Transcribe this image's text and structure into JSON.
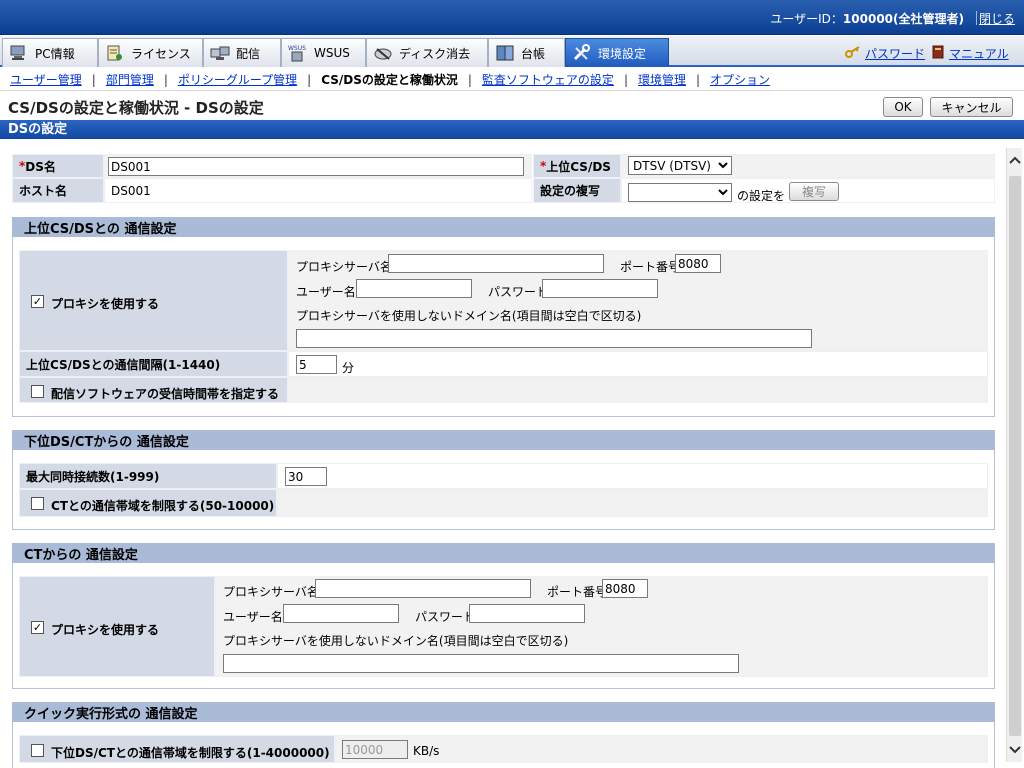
{
  "header": {
    "user_label": "ユーザーID：",
    "user_value": "100000(全社管理者)",
    "close_label": "閉じる"
  },
  "tabs": [
    {
      "label": "PC情報",
      "icon": "pc-icon"
    },
    {
      "label": "ライセンス",
      "icon": "license-icon"
    },
    {
      "label": "配信",
      "icon": "distribute-icon"
    },
    {
      "label": "WSUS",
      "icon": "wsus-icon"
    },
    {
      "label": "ディスク消去",
      "icon": "disk-erase-icon"
    },
    {
      "label": "台帳",
      "icon": "ledger-icon"
    },
    {
      "label": "環境設定",
      "icon": "settings-tools-icon",
      "active": true
    }
  ],
  "tab_links": {
    "password": "パスワード",
    "manual": "マニュアル"
  },
  "subnav": [
    {
      "label": "ユーザー管理",
      "link": true
    },
    {
      "label": "部門管理",
      "link": true
    },
    {
      "label": "ポリシーグループ管理",
      "link": true
    },
    {
      "label": "CS/DSの設定と稼働状況",
      "link": false
    },
    {
      "label": "監査ソフトウェアの設定",
      "link": true
    },
    {
      "label": "環境管理",
      "link": true
    },
    {
      "label": "オプション",
      "link": true
    }
  ],
  "page": {
    "title": "CS/DSの設定と稼働状況 - DSの設定",
    "ok_label": "OK",
    "cancel_label": "キャンセル",
    "section_title": "DSの設定"
  },
  "basic": {
    "ds_name_label": "DS名",
    "ds_name_value": "DS001",
    "parent_label": "上位CS/DS",
    "parent_value": "DTSV (DTSV)",
    "host_label": "ホスト名",
    "host_value": "DS001",
    "copy_label": "設定の複写",
    "copy_suffix": "の設定を",
    "copy_button": "複写"
  },
  "upper": {
    "title": "上位CS/DSとの 通信設定",
    "use_proxy_label": "プロキシを使用する",
    "use_proxy_checked": true,
    "proxy_server_label": "プロキシサーバ名",
    "port_label": "ポート番号",
    "port_value": "8080",
    "user_label": "ユーザー名",
    "password_label": "パスワード",
    "no_proxy_label": "プロキシサーバを使用しないドメイン名(項目間は空白で区切る)",
    "interval_label": "上位CS/DSとの通信間隔(1-1440)",
    "interval_value": "5",
    "interval_unit": "分",
    "recv_time_label": "配信ソフトウェアの受信時間帯を指定する",
    "recv_time_checked": false
  },
  "lower": {
    "title": "下位DS/CTからの 通信設定",
    "max_conn_label": "最大同時接続数(1-999)",
    "max_conn_value": "30",
    "bandwidth_label": "CTとの通信帯域を制限する(50-10000)",
    "bandwidth_checked": false
  },
  "ct": {
    "title": "CTからの 通信設定",
    "use_proxy_label": "プロキシを使用する",
    "use_proxy_checked": true,
    "proxy_server_label": "プロキシサーバ名",
    "port_label": "ポート番号",
    "port_value": "8080",
    "user_label": "ユーザー名",
    "password_label": "パスワード",
    "no_proxy_label": "プロキシサーバを使用しないドメイン名(項目間は空白で区切る)"
  },
  "quick": {
    "title": "クイック実行形式の 通信設定",
    "bandwidth_label": "下位DS/CTとの通信帯域を制限する(1-4000000)",
    "bandwidth_checked": false,
    "bandwidth_value": "10000",
    "bandwidth_unit": "KB/s"
  }
}
